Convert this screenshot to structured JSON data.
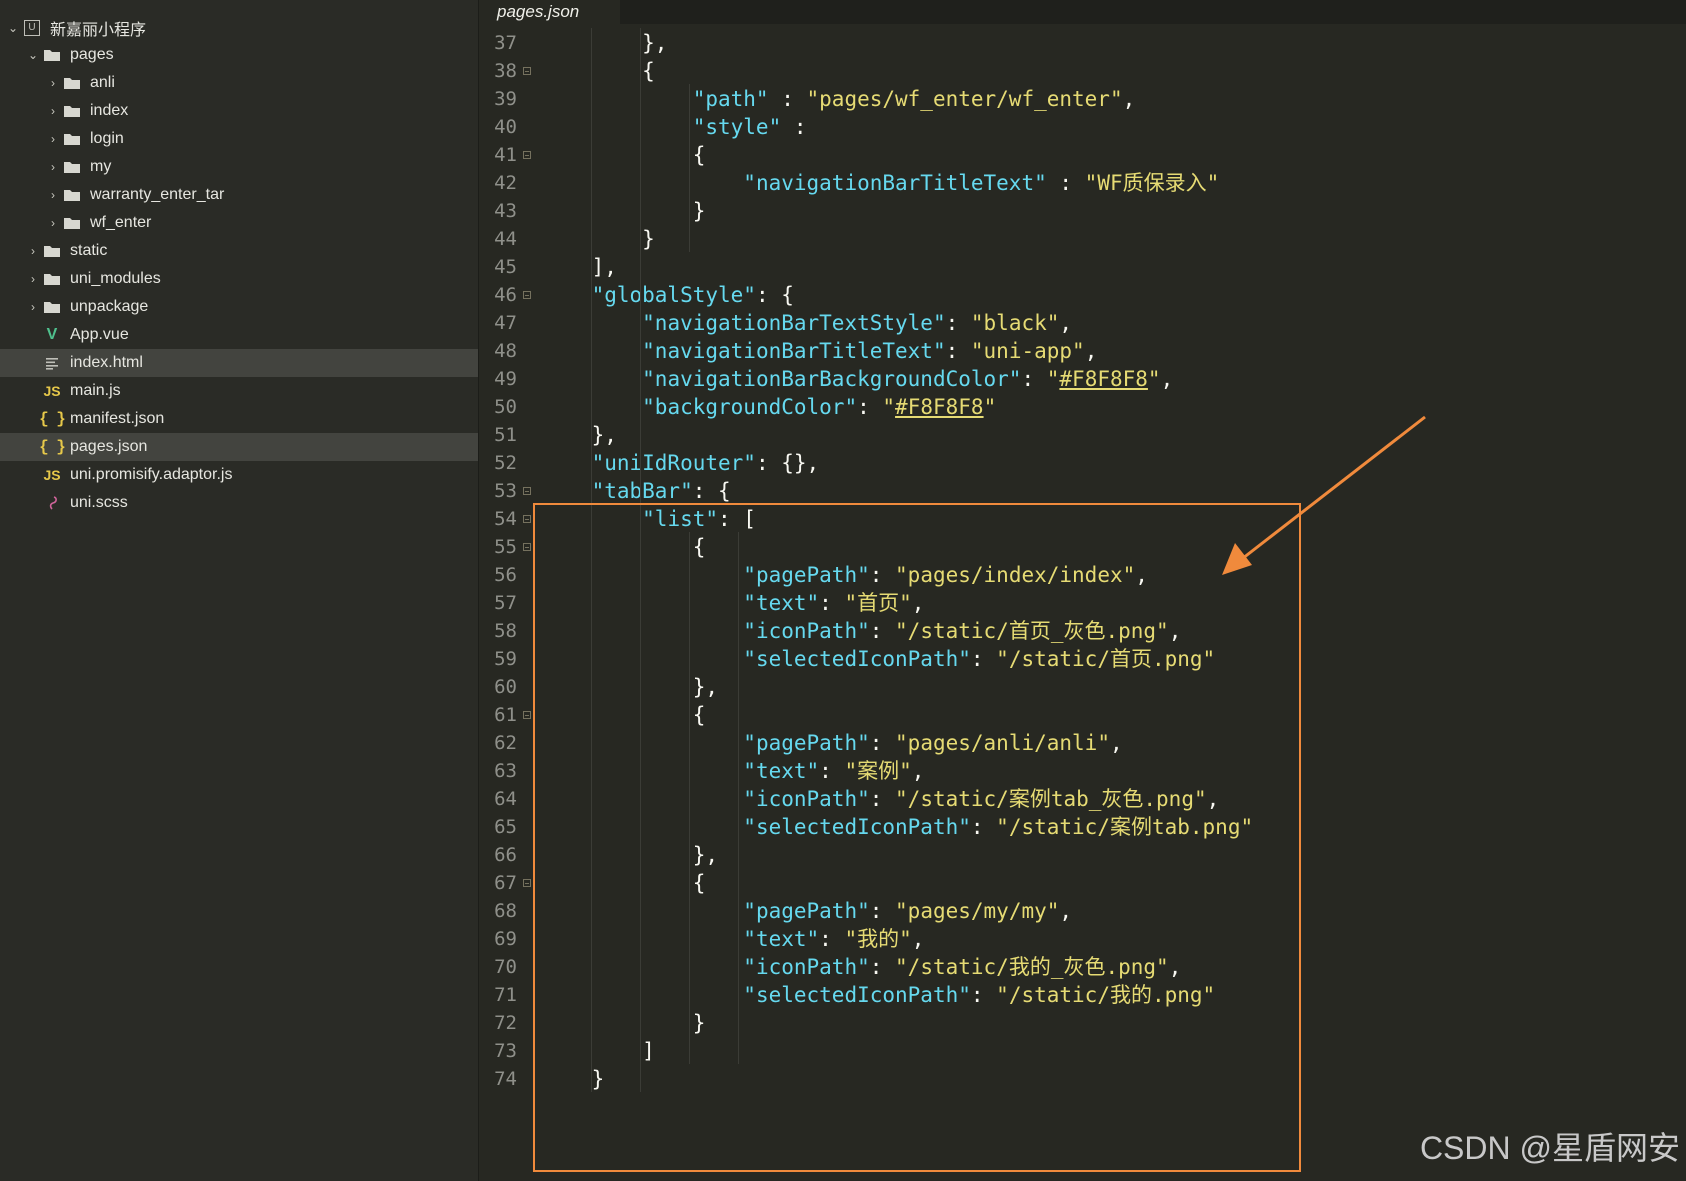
{
  "window": {
    "active_tab": "pages.json"
  },
  "sidebar": {
    "project": {
      "label": "新嘉丽小程序",
      "badge": "U"
    },
    "items": [
      {
        "label": "pages",
        "kind": "folder",
        "chevron": "expanded"
      },
      {
        "label": "anli",
        "kind": "folder",
        "chevron": "collapsed"
      },
      {
        "label": "index",
        "kind": "folder",
        "chevron": "collapsed"
      },
      {
        "label": "login",
        "kind": "folder",
        "chevron": "collapsed"
      },
      {
        "label": "my",
        "kind": "folder",
        "chevron": "collapsed"
      },
      {
        "label": "warranty_enter_tar",
        "kind": "folder",
        "chevron": "collapsed"
      },
      {
        "label": "wf_enter",
        "kind": "folder",
        "chevron": "collapsed"
      },
      {
        "label": "static",
        "kind": "folder",
        "chevron": "collapsed"
      },
      {
        "label": "uni_modules",
        "kind": "folder",
        "chevron": "collapsed"
      },
      {
        "label": "unpackage",
        "kind": "folder",
        "chevron": "collapsed"
      },
      {
        "label": "App.vue",
        "kind": "vue",
        "badge": "V"
      },
      {
        "label": "index.html",
        "kind": "html"
      },
      {
        "label": "main.js",
        "kind": "js",
        "badge": "JS"
      },
      {
        "label": "manifest.json",
        "kind": "json",
        "badge": "{ }"
      },
      {
        "label": "pages.json",
        "kind": "json",
        "badge": "{ }"
      },
      {
        "label": "uni.promisify.adaptor.js",
        "kind": "js",
        "badge": "JS"
      },
      {
        "label": "uni.scss",
        "kind": "scss"
      }
    ]
  },
  "editor": {
    "lines": [
      {
        "n": "37",
        "text": "        },"
      },
      {
        "n": "38",
        "text": "        {"
      },
      {
        "n": "39",
        "text": "            \"path\" : \"pages/wf_enter/wf_enter\","
      },
      {
        "n": "40",
        "text": "            \"style\" :"
      },
      {
        "n": "41",
        "text": "            {"
      },
      {
        "n": "42",
        "text": "                \"navigationBarTitleText\" : \"WF质保录入\""
      },
      {
        "n": "43",
        "text": "            }"
      },
      {
        "n": "44",
        "text": "        }"
      },
      {
        "n": "45",
        "text": "    ],"
      },
      {
        "n": "46",
        "text": "    \"globalStyle\": {"
      },
      {
        "n": "47",
        "text": "        \"navigationBarTextStyle\": \"black\","
      },
      {
        "n": "48",
        "text": "        \"navigationBarTitleText\": \"uni-app\","
      },
      {
        "n": "49",
        "text": "        \"navigationBarBackgroundColor\": \"#F8F8F8\","
      },
      {
        "n": "50",
        "text": "        \"backgroundColor\": \"#F8F8F8\""
      },
      {
        "n": "51",
        "text": "    },"
      },
      {
        "n": "52",
        "text": "    \"uniIdRouter\": {},"
      },
      {
        "n": "53",
        "text": "    \"tabBar\": {"
      },
      {
        "n": "54",
        "text": "        \"list\": ["
      },
      {
        "n": "55",
        "text": "            {"
      },
      {
        "n": "56",
        "text": "                \"pagePath\": \"pages/index/index\","
      },
      {
        "n": "57",
        "text": "                \"text\": \"首页\","
      },
      {
        "n": "58",
        "text": "                \"iconPath\": \"/static/首页_灰色.png\","
      },
      {
        "n": "59",
        "text": "                \"selectedIconPath\": \"/static/首页.png\""
      },
      {
        "n": "60",
        "text": "            },"
      },
      {
        "n": "61",
        "text": "            {"
      },
      {
        "n": "62",
        "text": "                \"pagePath\": \"pages/anli/anli\","
      },
      {
        "n": "63",
        "text": "                \"text\": \"案例\","
      },
      {
        "n": "64",
        "text": "                \"iconPath\": \"/static/案例tab_灰色.png\","
      },
      {
        "n": "65",
        "text": "                \"selectedIconPath\": \"/static/案例tab.png\""
      },
      {
        "n": "66",
        "text": "            },"
      },
      {
        "n": "67",
        "text": "            {"
      },
      {
        "n": "68",
        "text": "                \"pagePath\": \"pages/my/my\","
      },
      {
        "n": "69",
        "text": "                \"text\": \"我的\","
      },
      {
        "n": "70",
        "text": "                \"iconPath\": \"/static/我的_灰色.png\","
      },
      {
        "n": "71",
        "text": "                \"selectedIconPath\": \"/static/我的.png\""
      },
      {
        "n": "72",
        "text": "            }"
      },
      {
        "n": "73",
        "text": "        ]"
      },
      {
        "n": "74",
        "text": "    }"
      }
    ]
  },
  "annotation": {
    "color": "#f08a3c"
  },
  "watermark": "CSDN @星盾网安",
  "colors": {
    "background": "#272822",
    "key": "#66d9ef",
    "string": "#e6db74",
    "text": "#f8f8f2"
  }
}
